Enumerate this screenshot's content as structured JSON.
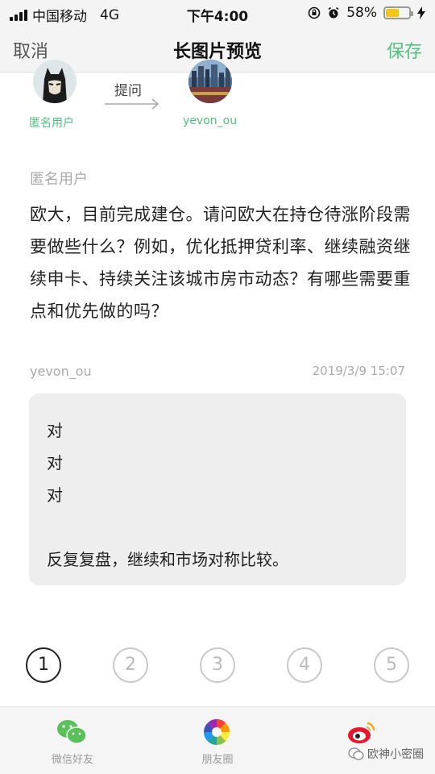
{
  "status_bar": {
    "carrier": "中国移动",
    "network": "4G",
    "time": "下午4:00",
    "battery_percent": "58%",
    "battery_level": 0.58
  },
  "nav": {
    "cancel_label": "取消",
    "title": "长图片预览",
    "save_label": "保存"
  },
  "header": {
    "asker_name": "匿名用户",
    "ask_label": "提问",
    "answerer_name": "yevon_ou"
  },
  "question": {
    "author": "匿名用户",
    "text": "欧大，目前完成建仓。请问欧大在持仓待涨阶段需要做些什么？例如，优化抵押贷利率、继续融资继续申卡、持续关注该城市房市动态？有哪些需要重点和优先做的吗？"
  },
  "answer": {
    "author": "yevon_ou",
    "timestamp": "2019/3/9 15:07",
    "lines": [
      "对",
      "对",
      "对",
      "",
      "反复复盘，继续和市场对称比较。"
    ]
  },
  "pager": {
    "pages": [
      "1",
      "2",
      "3",
      "4",
      "5"
    ],
    "active_page": "1"
  },
  "share_bar": {
    "wechat_label": "微信好友",
    "moments_label": "朋友圈",
    "watermark": "欧神小密圈"
  },
  "colors": {
    "accent_green": "#52c07f",
    "battery_yellow": "#f5c518",
    "bubble_bg": "#eeeeee"
  }
}
